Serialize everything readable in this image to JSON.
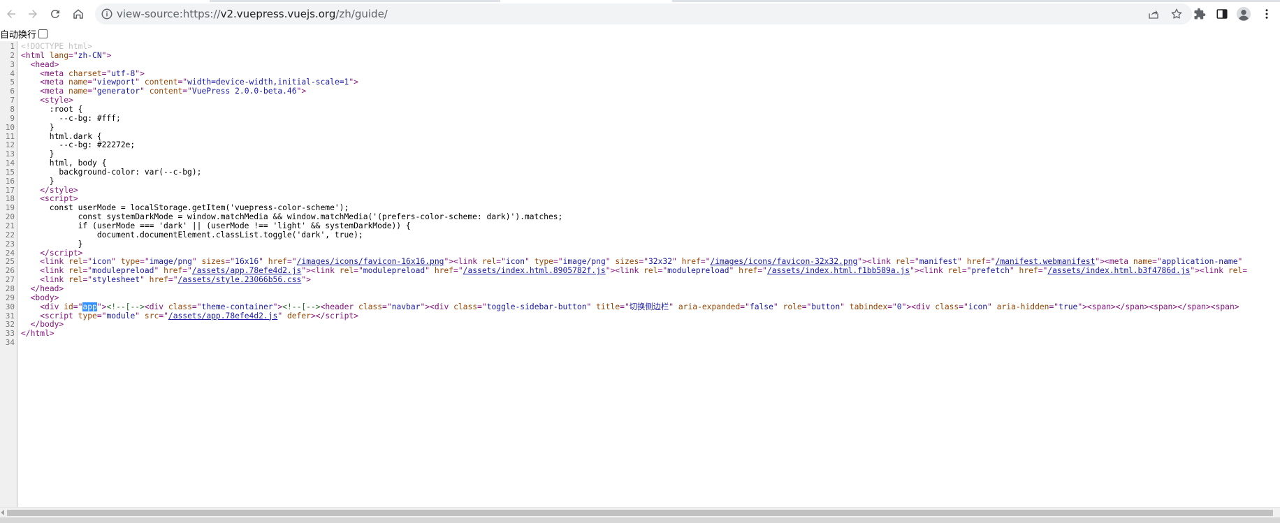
{
  "browser": {
    "url_scheme": "view-source:https://",
    "url_host": "v2.vuepress.vuejs.org",
    "url_path": "/zh/guide/",
    "icons": [
      "back-icon",
      "forward-icon",
      "reload-icon",
      "home-icon",
      "info-icon",
      "share-icon",
      "bookmark-star-icon",
      "extensions-icon",
      "side-panel-icon",
      "profile-icon",
      "menu-icon"
    ]
  },
  "wrap": {
    "label": "自动换行",
    "checked": false
  },
  "lines": [
    {
      "n": "1",
      "html": "<span class=\"doctype\">&lt;!DOCTYPE html&gt;</span>"
    },
    {
      "n": "2",
      "html": "<span class=\"tag\">&lt;html </span><span class=\"attr-name\">lang</span><span class=\"tag\">=\"</span><span class=\"attr-val\">zh-CN</span><span class=\"tag\">\"&gt;</span>"
    },
    {
      "n": "3",
      "html": "  <span class=\"tag\">&lt;head&gt;</span>"
    },
    {
      "n": "4",
      "html": "    <span class=\"tag\">&lt;meta </span><span class=\"attr-name\">charset</span><span class=\"tag\">=\"</span><span class=\"attr-val\">utf-8</span><span class=\"tag\">\"&gt;</span>"
    },
    {
      "n": "5",
      "html": "    <span class=\"tag\">&lt;meta </span><span class=\"attr-name\">name</span><span class=\"tag\">=\"</span><span class=\"attr-val\">viewport</span><span class=\"tag\">\" </span><span class=\"attr-name\">content</span><span class=\"tag\">=\"</span><span class=\"attr-val\">width=device-width,initial-scale=1</span><span class=\"tag\">\"&gt;</span>"
    },
    {
      "n": "6",
      "html": "    <span class=\"tag\">&lt;meta </span><span class=\"attr-name\">name</span><span class=\"tag\">=\"</span><span class=\"attr-val\">generator</span><span class=\"tag\">\" </span><span class=\"attr-name\">content</span><span class=\"tag\">=\"</span><span class=\"attr-val\">VuePress 2.0.0-beta.46</span><span class=\"tag\">\"&gt;</span>"
    },
    {
      "n": "7",
      "html": "    <span class=\"tag\">&lt;style&gt;</span>"
    },
    {
      "n": "8",
      "html": "      :root {"
    },
    {
      "n": "9",
      "html": "        --c-bg: #fff;"
    },
    {
      "n": "10",
      "html": "      }"
    },
    {
      "n": "11",
      "html": "      html.dark {"
    },
    {
      "n": "12",
      "html": "        --c-bg: #22272e;"
    },
    {
      "n": "13",
      "html": "      }"
    },
    {
      "n": "14",
      "html": "      html, body {"
    },
    {
      "n": "15",
      "html": "        background-color: var(--c-bg);"
    },
    {
      "n": "16",
      "html": "      }"
    },
    {
      "n": "17",
      "html": "    <span class=\"tag\">&lt;/style&gt;</span>"
    },
    {
      "n": "18",
      "html": "    <span class=\"tag\">&lt;script&gt;</span>"
    },
    {
      "n": "19",
      "html": "      const userMode = localStorage.getItem('vuepress-color-scheme');"
    },
    {
      "n": "20",
      "html": "            const systemDarkMode = window.matchMedia &amp;&amp; window.matchMedia('(prefers-color-scheme: dark)').matches;"
    },
    {
      "n": "21",
      "html": "            if (userMode === 'dark' || (userMode !== 'light' &amp;&amp; systemDarkMode)) {"
    },
    {
      "n": "22",
      "html": "                document.documentElement.classList.toggle('dark', true);"
    },
    {
      "n": "23",
      "html": "            }"
    },
    {
      "n": "24",
      "html": "    <span class=\"tag\">&lt;/script&gt;</span>"
    },
    {
      "n": "25",
      "html": "    <span class=\"tag\">&lt;link </span><span class=\"attr-name\">rel</span><span class=\"tag\">=\"</span><span class=\"attr-val\">icon</span><span class=\"tag\">\" </span><span class=\"attr-name\">type</span><span class=\"tag\">=\"</span><span class=\"attr-val\">image/png</span><span class=\"tag\">\" </span><span class=\"attr-name\">sizes</span><span class=\"tag\">=\"</span><span class=\"attr-val\">16x16</span><span class=\"tag\">\" </span><span class=\"attr-name\">href</span><span class=\"tag\">=\"</span><span class=\"link\">/images/icons/favicon-16x16.png</span><span class=\"tag\">\"&gt;&lt;link </span><span class=\"attr-name\">rel</span><span class=\"tag\">=\"</span><span class=\"attr-val\">icon</span><span class=\"tag\">\" </span><span class=\"attr-name\">type</span><span class=\"tag\">=\"</span><span class=\"attr-val\">image/png</span><span class=\"tag\">\" </span><span class=\"attr-name\">sizes</span><span class=\"tag\">=\"</span><span class=\"attr-val\">32x32</span><span class=\"tag\">\" </span><span class=\"attr-name\">href</span><span class=\"tag\">=\"</span><span class=\"link\">/images/icons/favicon-32x32.png</span><span class=\"tag\">\"&gt;&lt;link </span><span class=\"attr-name\">rel</span><span class=\"tag\">=\"</span><span class=\"attr-val\">manifest</span><span class=\"tag\">\" </span><span class=\"attr-name\">href</span><span class=\"tag\">=\"</span><span class=\"link\">/manifest.webmanifest</span><span class=\"tag\">\"&gt;&lt;meta </span><span class=\"attr-name\">name</span><span class=\"tag\">=\"</span><span class=\"attr-val\">application-name</span><span class=\"tag\">\"</span>"
    },
    {
      "n": "26",
      "html": "    <span class=\"tag\">&lt;link </span><span class=\"attr-name\">rel</span><span class=\"tag\">=\"</span><span class=\"attr-val\">modulepreload</span><span class=\"tag\">\" </span><span class=\"attr-name\">href</span><span class=\"tag\">=\"</span><span class=\"link\">/assets/app.78efe4d2.js</span><span class=\"tag\">\"&gt;&lt;link </span><span class=\"attr-name\">rel</span><span class=\"tag\">=\"</span><span class=\"attr-val\">modulepreload</span><span class=\"tag\">\" </span><span class=\"attr-name\">href</span><span class=\"tag\">=\"</span><span class=\"link\">/assets/index.html.8905782f.js</span><span class=\"tag\">\"&gt;&lt;link </span><span class=\"attr-name\">rel</span><span class=\"tag\">=\"</span><span class=\"attr-val\">modulepreload</span><span class=\"tag\">\" </span><span class=\"attr-name\">href</span><span class=\"tag\">=\"</span><span class=\"link\">/assets/index.html.f1bb589a.js</span><span class=\"tag\">\"&gt;&lt;link </span><span class=\"attr-name\">rel</span><span class=\"tag\">=\"</span><span class=\"attr-val\">prefetch</span><span class=\"tag\">\" </span><span class=\"attr-name\">href</span><span class=\"tag\">=\"</span><span class=\"link\">/assets/index.html.b3f4786d.js</span><span class=\"tag\">\"&gt;&lt;link </span><span class=\"attr-name\">rel</span><span class=\"tag\">=</span>"
    },
    {
      "n": "27",
      "html": "    <span class=\"tag\">&lt;link </span><span class=\"attr-name\">rel</span><span class=\"tag\">=\"</span><span class=\"attr-val\">stylesheet</span><span class=\"tag\">\" </span><span class=\"attr-name\">href</span><span class=\"tag\">=\"</span><span class=\"link\">/assets/style.23066b56.css</span><span class=\"tag\">\"&gt;</span>"
    },
    {
      "n": "28",
      "html": "  <span class=\"tag\">&lt;/head&gt;</span>"
    },
    {
      "n": "29",
      "html": "  <span class=\"tag\">&lt;body&gt;</span>"
    },
    {
      "n": "30",
      "html": "    <span class=\"tag\">&lt;div </span><span class=\"attr-name\">id</span><span class=\"tag\">=\"</span><span class=\"attr-val sel\">app</span><span class=\"tag\">\"&gt;</span><span class=\"comment\">&lt;!--[--&gt;</span><span class=\"tag\">&lt;div </span><span class=\"attr-name\">class</span><span class=\"tag\">=\"</span><span class=\"attr-val\">theme-container</span><span class=\"tag\">\"&gt;</span><span class=\"comment\">&lt;!--[--&gt;</span><span class=\"tag\">&lt;header </span><span class=\"attr-name\">class</span><span class=\"tag\">=\"</span><span class=\"attr-val\">navbar</span><span class=\"tag\">\"&gt;&lt;div </span><span class=\"attr-name\">class</span><span class=\"tag\">=\"</span><span class=\"attr-val\">toggle-sidebar-button</span><span class=\"tag\">\" </span><span class=\"attr-name\">title</span><span class=\"tag\">=\"</span><span class=\"attr-val\">切换侧边栏</span><span class=\"tag\">\" </span><span class=\"attr-name\">aria-expanded</span><span class=\"tag\">=\"</span><span class=\"attr-val\">false</span><span class=\"tag\">\" </span><span class=\"attr-name\">role</span><span class=\"tag\">=\"</span><span class=\"attr-val\">button</span><span class=\"tag\">\" </span><span class=\"attr-name\">tabindex</span><span class=\"tag\">=\"</span><span class=\"attr-val\">0</span><span class=\"tag\">\"&gt;&lt;div </span><span class=\"attr-name\">class</span><span class=\"tag\">=\"</span><span class=\"attr-val\">icon</span><span class=\"tag\">\" </span><span class=\"attr-name\">aria-hidden</span><span class=\"tag\">=\"</span><span class=\"attr-val\">true</span><span class=\"tag\">\"&gt;&lt;span&gt;&lt;/span&gt;&lt;span&gt;&lt;/span&gt;&lt;span&gt;</span>"
    },
    {
      "n": "31",
      "html": "    <span class=\"tag\">&lt;script </span><span class=\"attr-name\">type</span><span class=\"tag\">=\"</span><span class=\"attr-val\">module</span><span class=\"tag\">\" </span><span class=\"attr-name\">src</span><span class=\"tag\">=\"</span><span class=\"link\">/assets/app.78efe4d2.js</span><span class=\"tag\">\" </span><span class=\"attr-name\">defer</span><span class=\"tag\">&gt;&lt;/script&gt;</span>"
    },
    {
      "n": "32",
      "html": "  <span class=\"tag\">&lt;/body&gt;</span>"
    },
    {
      "n": "33",
      "html": "<span class=\"tag\">&lt;/html&gt;</span>"
    },
    {
      "n": "34",
      "html": ""
    }
  ]
}
